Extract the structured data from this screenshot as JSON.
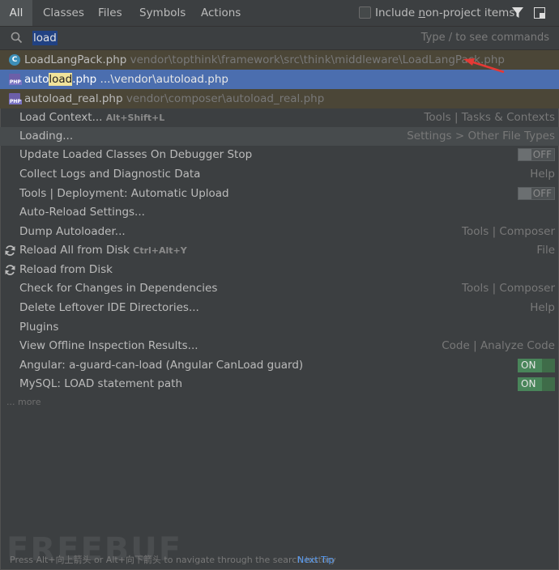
{
  "tabs": [
    "All",
    "Classes",
    "Files",
    "Symbols",
    "Actions"
  ],
  "include_non_project": {
    "prefix": "Include ",
    "underlined": "n",
    "rest": "on-project items",
    "checked": false
  },
  "icons": {
    "filter": "funnel-filter-icon",
    "pin": "pin-window-icon",
    "search": "search-icon",
    "reload": "reload-arrows-icon"
  },
  "search": {
    "value": "load",
    "hint": "Type / to see commands"
  },
  "files": [
    {
      "icon": "class-c-icon",
      "name": "LoadLangPack.php",
      "path": " vendor\\topthink\\framework\\src\\think\\middleware\\LoadLangPack.php"
    },
    {
      "icon": "php-file-icon",
      "name_pre": "auto",
      "name_hl": "load",
      "name_post": ".php",
      "path": " ...\\vendor\\autoload.php"
    },
    {
      "icon": "php-file-icon",
      "name": "autoload_real.php",
      "path": " vendor\\composer\\autoload_real.php"
    }
  ],
  "actions": [
    {
      "label": "Load Context...",
      "shortcut": "Alt+Shift+L",
      "right": "Tools | Tasks & Contexts"
    },
    {
      "label": "Loading...",
      "right": "Settings > Other File Types"
    },
    {
      "label": "Update Loaded Classes On Debugger Stop",
      "toggle": "OFF"
    },
    {
      "label": "Collect Logs and Diagnostic Data",
      "right": "Help"
    },
    {
      "label": "Tools | Deployment: Automatic Upload",
      "toggle": "OFF"
    },
    {
      "label": "Auto-Reload Settings..."
    },
    {
      "label": "Dump Autoloader...",
      "right": "Tools | Composer"
    },
    {
      "label": "Reload All from Disk",
      "shortcut": "Ctrl+Alt+Y",
      "right": "File"
    },
    {
      "label": "Reload from Disk"
    },
    {
      "label": "Check for Changes in Dependencies",
      "right": "Tools | Composer"
    },
    {
      "label": "Delete Leftover IDE Directories...",
      "right": "Help"
    },
    {
      "label": "Plugins"
    },
    {
      "label": "View Offline Inspection Results...",
      "right": "Code | Analyze Code"
    },
    {
      "label": "Angular: a-guard-can-load (Angular CanLoad guard)",
      "toggle": "ON"
    },
    {
      "label": "MySQL: LOAD statement path",
      "toggle": "ON"
    }
  ],
  "more": "... more",
  "watermark": "FREEBUF",
  "footer": {
    "text": "Press Alt+向上箭头 or Alt+向下箭头 to navigate through the search history",
    "tip": "Next Tip"
  },
  "colors": {
    "selected_row": "#4b6eaf",
    "match_highlight": "#f0e39a",
    "annotation_arrow": "#e53935",
    "toggle_on": "#49855a"
  }
}
